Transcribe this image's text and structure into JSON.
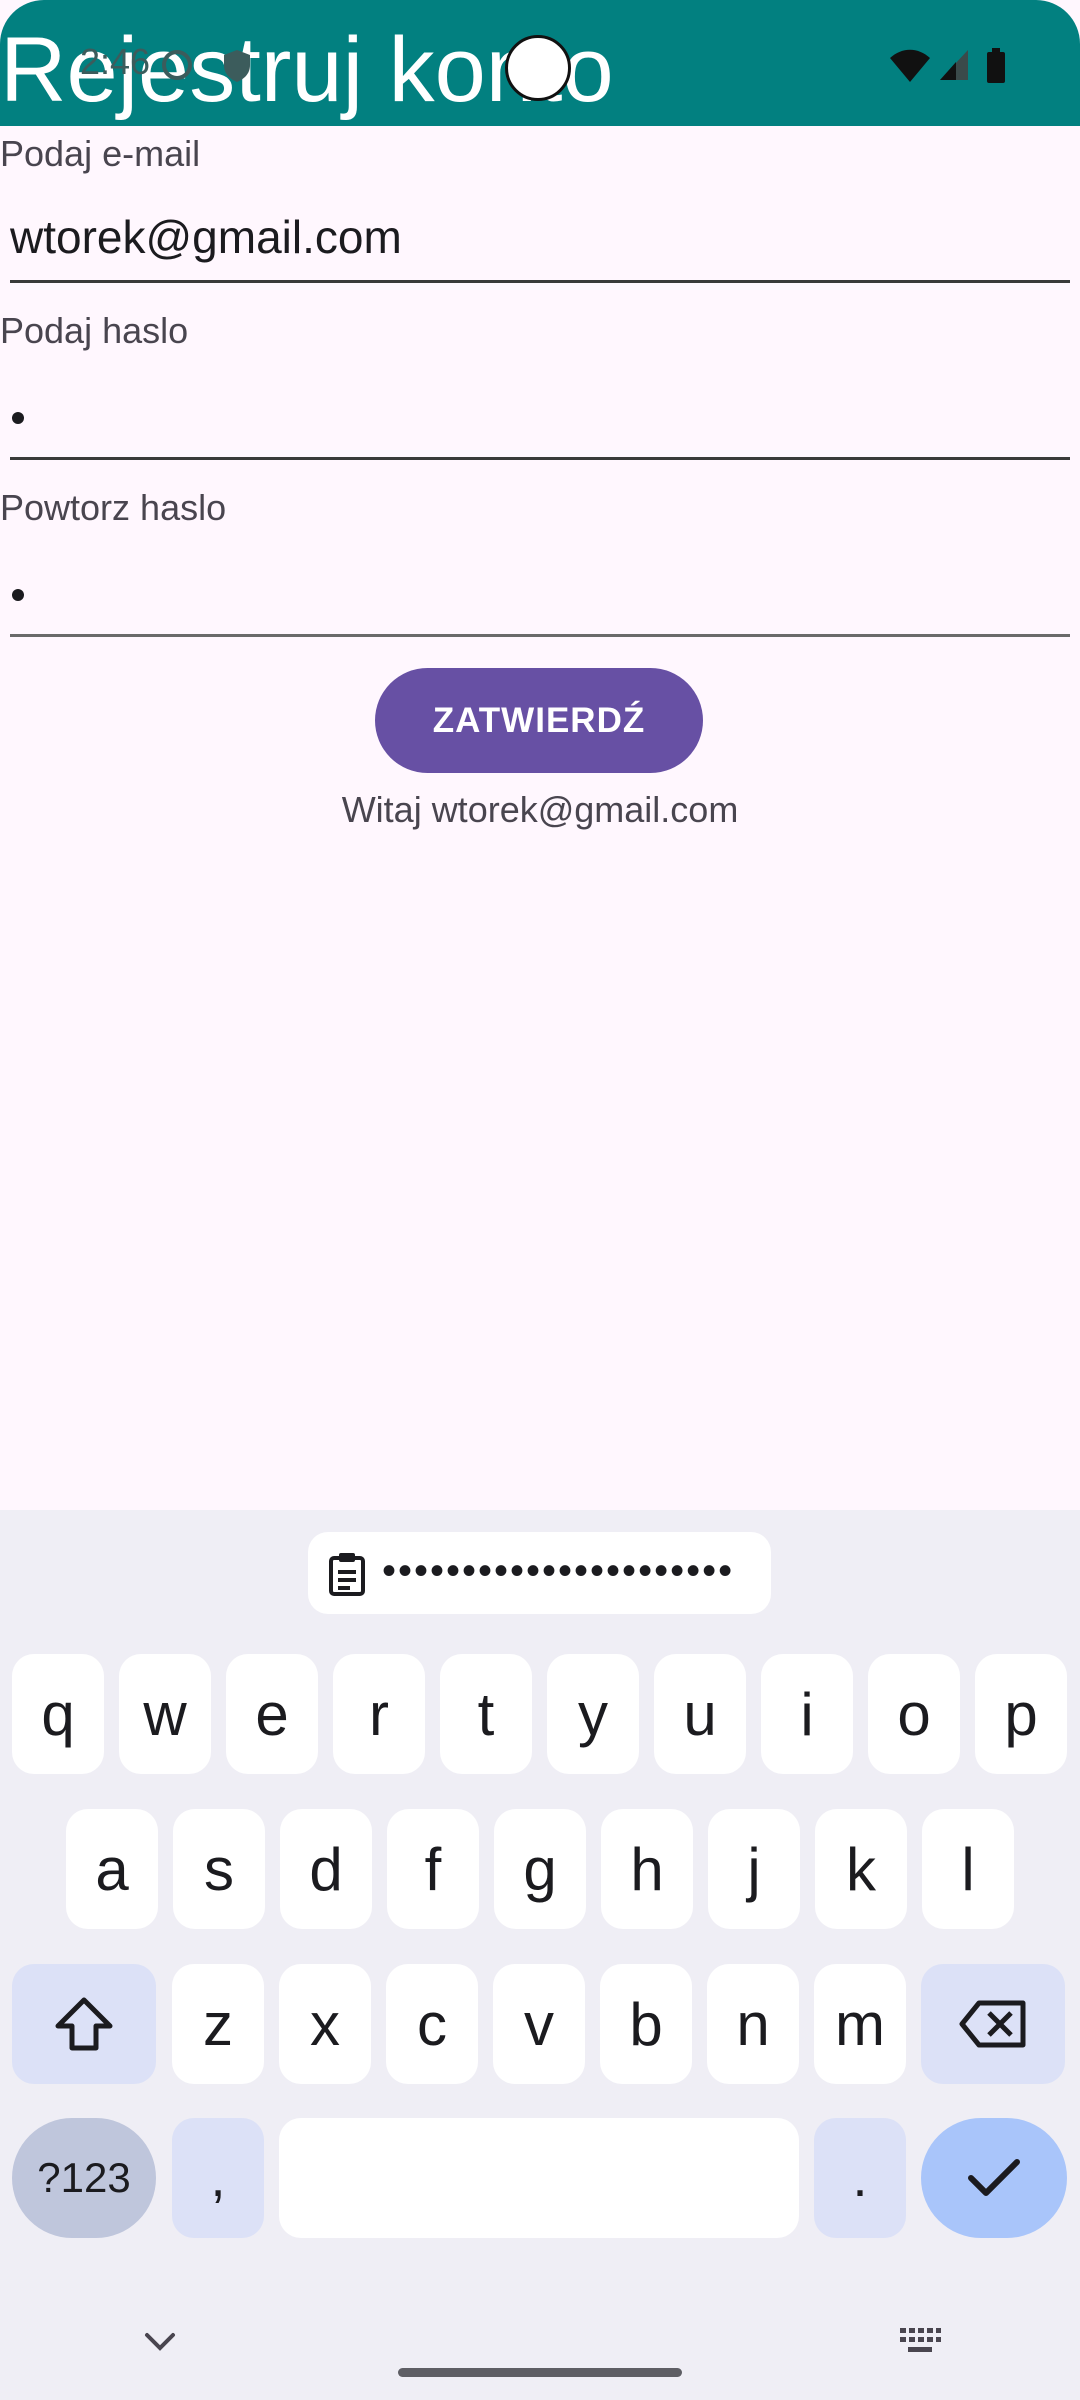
{
  "status_bar": {
    "time": "2:46"
  },
  "app_bar": {
    "title": "Rejestruj konto"
  },
  "form": {
    "email_label": "Podaj e-mail",
    "email_value": "wtorek@gmail.com",
    "password_label": "Podaj haslo",
    "repeat_label": "Powtorz haslo",
    "submit_label": "ZATWIERDŹ",
    "welcome_text": "Witaj wtorek@gmail.com"
  },
  "keyboard": {
    "clipboard_text": "••••••••••••••••••••••",
    "row1": [
      "q",
      "w",
      "e",
      "r",
      "t",
      "y",
      "u",
      "i",
      "o",
      "p"
    ],
    "row2": [
      "a",
      "s",
      "d",
      "f",
      "g",
      "h",
      "j",
      "k",
      "l"
    ],
    "row3": [
      "z",
      "x",
      "c",
      "v",
      "b",
      "n",
      "m"
    ],
    "symbols_label": "?123",
    "comma": ",",
    "period": "."
  },
  "colors": {
    "app_bar": "#028080",
    "button": "#6750A4",
    "background": "#FFF7FE",
    "keyboard": "#EFEEF5"
  }
}
